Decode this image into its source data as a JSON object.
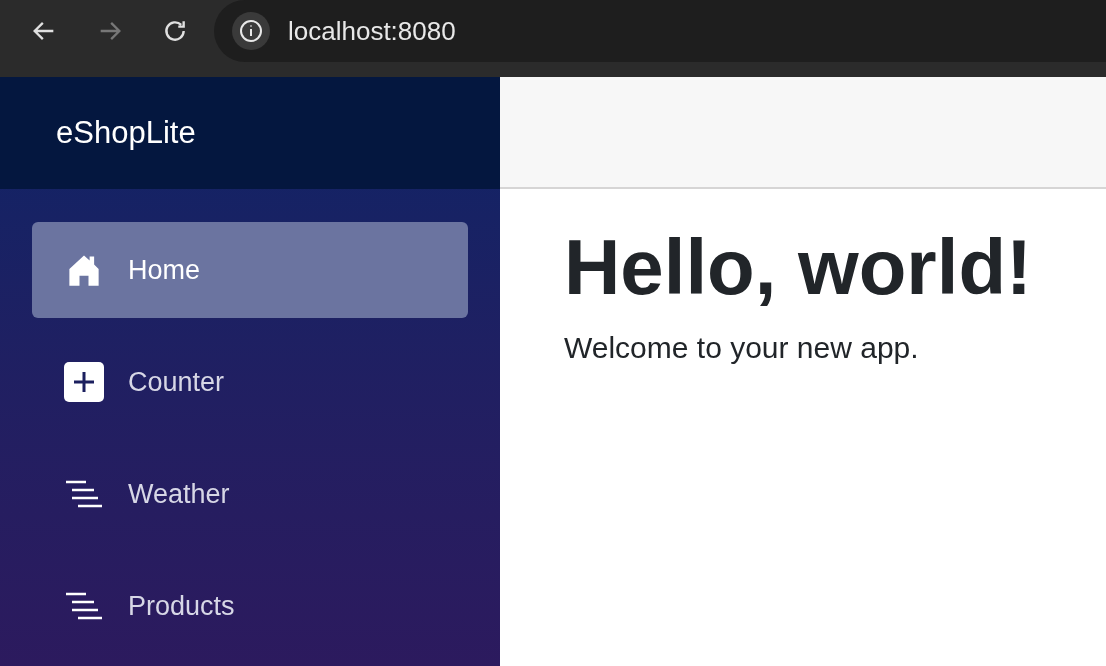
{
  "browser": {
    "url": "localhost:8080",
    "forward_disabled": true
  },
  "sidebar": {
    "brand": "eShopLite",
    "items": [
      {
        "label": "Home",
        "kind": "home",
        "selected": true
      },
      {
        "label": "Counter",
        "kind": "plus",
        "selected": false
      },
      {
        "label": "Weather",
        "kind": "list",
        "selected": false
      },
      {
        "label": "Products",
        "kind": "list",
        "selected": false
      }
    ]
  },
  "main": {
    "heading": "Hello, world!",
    "text": "Welcome to your new app."
  }
}
